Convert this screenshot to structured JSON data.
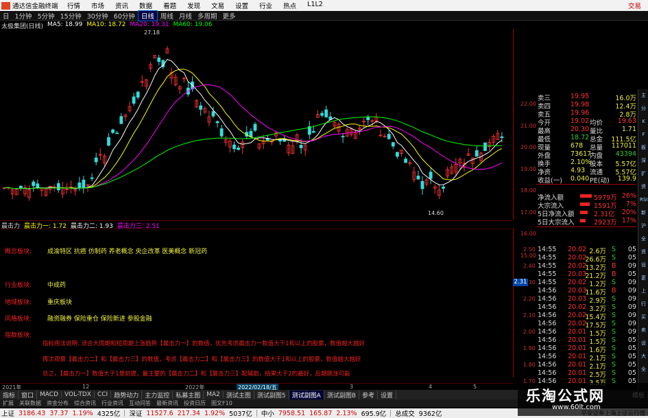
{
  "titlebar": {
    "app_name": "通达信金融终端",
    "menu": [
      "行情",
      "市场",
      "资讯",
      "数据",
      "看题",
      "发现",
      "文易",
      "设置",
      "行业",
      "热点",
      "L1L2"
    ],
    "trade": "交易"
  },
  "periodbar": {
    "items": [
      "日",
      "1分钟",
      "5分钟",
      "15分钟",
      "30分钟",
      "60分钟",
      "日线",
      "周线",
      "月线",
      "多周期",
      "更多"
    ],
    "active": "日线"
  },
  "ma_legend": {
    "name": "太极集团(日线)",
    "items": [
      {
        "label": "MA5: 18.99",
        "color": "#ffffff"
      },
      {
        "label": "MA10: 18.72",
        "color": "#ffff00"
      },
      {
        "label": "MA20: 19.31",
        "color": "#ff00ff"
      },
      {
        "label": "MA60: 19.06",
        "color": "#00ff00"
      }
    ]
  },
  "indicator_legend": {
    "name": "晨击力",
    "items": [
      {
        "label": "晨击力一: 1.72",
        "color": "#ffff00"
      },
      {
        "label": "晨击力二: 1.93",
        "color": "#ffffff"
      },
      {
        "label": "晨击力三: 2.51",
        "color": "#ff00ff"
      }
    ]
  },
  "info_rows": [
    {
      "label": "概念板块:",
      "value": "成渝特区 抗癌 仿制药 养老概念 央企改革 医美概念 新冠药"
    },
    {
      "label": "行业板块:",
      "value": "中成药"
    },
    {
      "label": "地域板块:",
      "value": "重庆板块"
    },
    {
      "label": "风格板块:",
      "value": "融资融券 保险重仓 保险新进 参股金融"
    },
    {
      "label": "指数板块:",
      "value": ""
    }
  ],
  "notes": [
    "指标用法说明: 适合大周期和短周期上涨趋势【晨击力一】的数值，优先考虑晨击力一数值大于1和以上的股票，数值越大越好",
    "再次观察【晨击力二】和【晨击力三】的数值，考虑【晨击力二】和【晨击力三】的数值大于1和以上的股票，数值越大越好",
    "总之，【晨击力一】数值大于1是前提，最主要的【晨击力二】和【晨击力三】配辅助，结果大于2的最好，后期跳涨可能"
  ],
  "price_scale": [
    "22.00",
    "21.00",
    "20.00",
    "19.00",
    "18.00",
    "17.00",
    "16.00",
    "15.00"
  ],
  "ind_scale": [
    "2.50",
    "2.40",
    "2.30",
    "2.20",
    "2.10",
    "2.00",
    "1.90",
    "1.80",
    "1.70"
  ],
  "current_value": "2.31",
  "chart_annotations": {
    "high": "27.18",
    "low": "14.60",
    "cursor_date": "2022/02/18/五"
  },
  "date_axis": [
    "2021年",
    "12",
    "2022年",
    "2",
    "3",
    "4",
    "5"
  ],
  "quotes": [
    {
      "label": "卖三",
      "price": "19.95",
      "vol": "16.0万"
    },
    {
      "label": "卖四",
      "price": "19.98",
      "vol": "12.4万"
    },
    {
      "label": "卖五",
      "price": "19.96",
      "vol": "2.8万"
    },
    {
      "label": "今开",
      "price": "19.02",
      "label2": "均价",
      "vol": "19.63"
    },
    {
      "label": "最高",
      "price": "20.30",
      "label2": "量比",
      "vol": "1.71"
    },
    {
      "label": "最低",
      "price": "18.72",
      "label2": "总金",
      "vol": "111.5亿"
    },
    {
      "label": "现量",
      "price": "678",
      "label2": "总量",
      "vol": "117011"
    },
    {
      "label": "外盘",
      "price": "73617",
      "label2": "内盘",
      "vol": "43394"
    },
    {
      "label": "换手",
      "price": "2.10%",
      "label2": "股本",
      "vol": "5.57亿"
    },
    {
      "label": "净资",
      "price": "4.93",
      "label2": "流通",
      "vol": "5.57亿"
    },
    {
      "label": "收益(一)",
      "price": "0.040",
      "label2": "PE(动)",
      "vol": "139.9"
    }
  ],
  "flows": [
    {
      "label": "净流入额",
      "value": "5979万",
      "pct": "26%"
    },
    {
      "label": "大宗流入",
      "value": "1591万",
      "pct": "7%"
    },
    {
      "label": "5日净流入额",
      "value": "2.31亿",
      "pct": "20%"
    },
    {
      "label": "5日大宗流入",
      "value": "2923万",
      "pct": "17%"
    }
  ],
  "ticks": [
    {
      "time": "14:55",
      "price": "20.02",
      "vol": "2.6万",
      "bs": "S",
      "n": "05"
    },
    {
      "time": "14:55",
      "price": "20.02",
      "vol": "26.6万",
      "bs": "S",
      "n": "05"
    },
    {
      "time": "14:55",
      "price": "20.02",
      "vol": "13.2万",
      "bs": "B",
      "n": "09"
    },
    {
      "time": "14:55",
      "price": "20.03",
      "vol": "21.2万",
      "bs": "B",
      "n": "05"
    },
    {
      "time": "14:55",
      "price": "20.02",
      "vol": "1.2万",
      "bs": "S",
      "n": "09"
    },
    {
      "time": "14:56",
      "price": "20.03",
      "vol": "11.6万",
      "bs": "B",
      "n": "09"
    },
    {
      "time": "14:56",
      "price": "20.03",
      "vol": "2.9万",
      "bs": "S",
      "n": "09"
    },
    {
      "time": "14:56",
      "price": "20.02",
      "vol": "3.2万",
      "bs": "S",
      "n": "09"
    },
    {
      "time": "14:56",
      "price": "20.02",
      "vol": "15.4万",
      "bs": "S",
      "n": "09"
    },
    {
      "time": "14:56",
      "price": "20.02",
      "vol": "17.5万",
      "bs": "S",
      "n": "09"
    },
    {
      "time": "14:56",
      "price": "20.01",
      "vol": "1.5万",
      "bs": "S",
      "n": "09"
    },
    {
      "time": "14:56",
      "price": "20.01",
      "vol": "1.5万",
      "bs": "S",
      "n": "05"
    },
    {
      "time": "14:56",
      "price": "20.01",
      "vol": "1.6万",
      "bs": "S",
      "n": "05"
    },
    {
      "time": "14:56",
      "price": "20.01",
      "vol": "2.1万",
      "bs": "S",
      "n": "05"
    },
    {
      "time": "14:56",
      "price": "20.01",
      "vol": "2.1万",
      "bs": "S",
      "n": "05"
    },
    {
      "time": "14:56",
      "price": "20.01",
      "vol": "2.5万",
      "bs": "S",
      "n": "05"
    },
    {
      "time": "14:56",
      "price": "20.01",
      "vol": "3.5万",
      "bs": "S",
      "n": "05"
    }
  ],
  "tabs": [
    "指标",
    "窗口",
    "MACD",
    "VOL-TDX",
    "CCI",
    "趋势动力",
    "主力监控",
    "私募主图",
    "MA2",
    "测试主图",
    "测试副图5",
    "测试副图A",
    "测试副图B",
    "参考",
    "设置"
  ],
  "active_tab": "测试副图A",
  "tabs_right": "模板",
  "tabs2": [
    "扩展",
    "关联数据",
    "资金分布",
    "综合资讯",
    "行业资讯",
    "互动问答",
    "最新资讯",
    "投资日历",
    "图文F10"
  ],
  "status": {
    "items": [
      {
        "name": "上证",
        "value": "3186.43",
        "chg": "37.37",
        "pct": "1.19%",
        "amt": "4325亿"
      },
      {
        "name": "深证",
        "value": "11527.6",
        "chg": "217.34",
        "pct": "1.92%",
        "amt": "5037亿"
      },
      {
        "name": "中小",
        "value": "7958.51",
        "chg": "165.87",
        "pct": "2.13%",
        "amt": "695.9亿"
      }
    ],
    "total_label": "总成交",
    "total": "9362亿",
    "broker": "平安证券上海上证云行情"
  },
  "watermark": {
    "title": "乐淘公式网",
    "url": "www.60lt.com"
  },
  "sidebar_icons": [
    "主",
    "分",
    "K",
    "F",
    "板",
    "深",
    "扩",
    "资",
    "RSI",
    "新",
    "沪",
    "全",
    "资",
    "设",
    "更",
    "上",
    "行",
    "买",
    "卖",
    "设",
    "大",
    "全"
  ],
  "colors": {
    "up": "#ff3333",
    "down": "#33cc33",
    "ma5": "#ffffff",
    "ma10": "#ffff00",
    "ma20": "#ff00ff",
    "ma60": "#00ff00",
    "accent": "#cc0000"
  }
}
